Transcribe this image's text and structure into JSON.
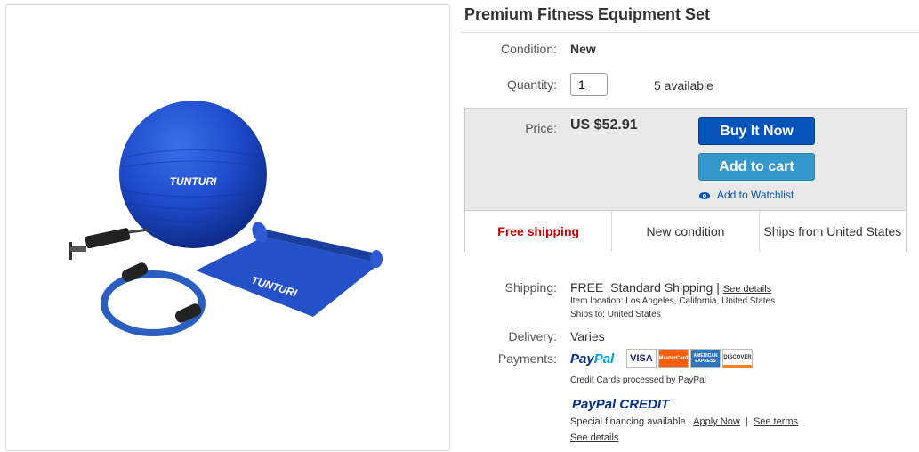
{
  "product": {
    "title": "Premium Fitness Equipment Set",
    "image_brand_text": "TUNTURI"
  },
  "condition": {
    "label": "Condition:",
    "value": "New"
  },
  "quantity": {
    "label": "Quantity:",
    "value": "1",
    "available": "5 available"
  },
  "price": {
    "label": "Price:",
    "value": "US $52.91"
  },
  "actions": {
    "buy_now": "Buy It Now",
    "add_to_cart": "Add to cart",
    "watchlist": "Add to Watchlist"
  },
  "highlights": [
    "Free shipping",
    "New condition",
    "Ships from United States"
  ],
  "shipping": {
    "label": "Shipping:",
    "free": "FREE",
    "method": "Standard Shipping",
    "sep": "|",
    "details_link": "See details",
    "item_location": "Item location:  Los Angeles, California, United States",
    "ships_to": "Ships to:  United States"
  },
  "delivery": {
    "label": "Delivery:",
    "value": "Varies"
  },
  "payments": {
    "label": "Payments:",
    "paypal_pay": "Pay",
    "paypal_pal": "Pal",
    "cards": [
      "VISA",
      "MasterCard",
      "AMERICAN EXPRESS",
      "DISCOVER"
    ],
    "note": "Credit Cards processed by PayPal",
    "credit_pay": "PayPal",
    "credit_word": "CREDIT",
    "financing": "Special financing available.",
    "apply_now": "Apply Now",
    "sep": "|",
    "see_terms": "See terms",
    "see_details": "See details"
  },
  "colors": {
    "buy_blue": "#0654ba",
    "cart_blue": "#3498ca",
    "free_red": "#cc0000",
    "paypal_dark": "#003087",
    "paypal_light": "#009cde"
  }
}
